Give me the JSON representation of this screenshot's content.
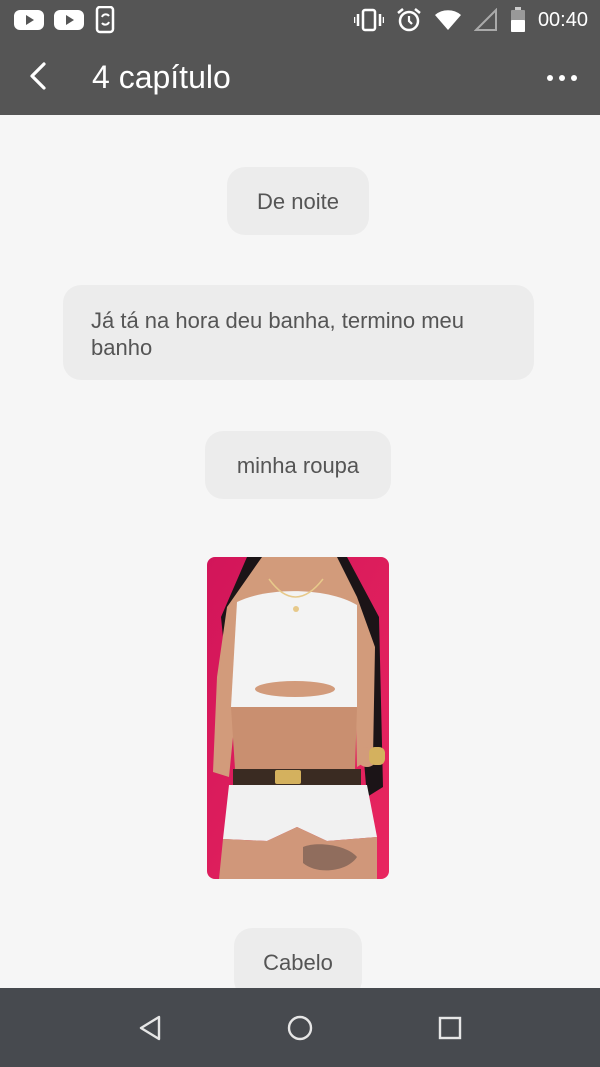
{
  "status_bar": {
    "time": "00:40",
    "left_icons": [
      "youtube-icon",
      "youtube-icon",
      "phone-sync-icon"
    ],
    "right_icons": [
      "vibrate-icon",
      "alarm-icon",
      "wifi-icon",
      "signal-icon",
      "battery-icon"
    ]
  },
  "app_bar": {
    "title": "4 capítulo",
    "back_icon": "back-arrow-icon",
    "menu_icon": "more-dots-icon"
  },
  "messages": [
    {
      "text": "De noite"
    },
    {
      "text": "Já tá na hora deu banha, termino meu banho"
    },
    {
      "text": "minha roupa"
    },
    {
      "image": "outfit-photo"
    },
    {
      "text": "Cabelo"
    }
  ],
  "nav_bar": {
    "icons": [
      "back-triangle-icon",
      "home-circle-icon",
      "recents-square-icon"
    ]
  },
  "colors": {
    "bar": "#555555",
    "nav": "#474a4f",
    "bubble": "#ececec",
    "background": "#f6f6f6",
    "text": "#555555"
  }
}
